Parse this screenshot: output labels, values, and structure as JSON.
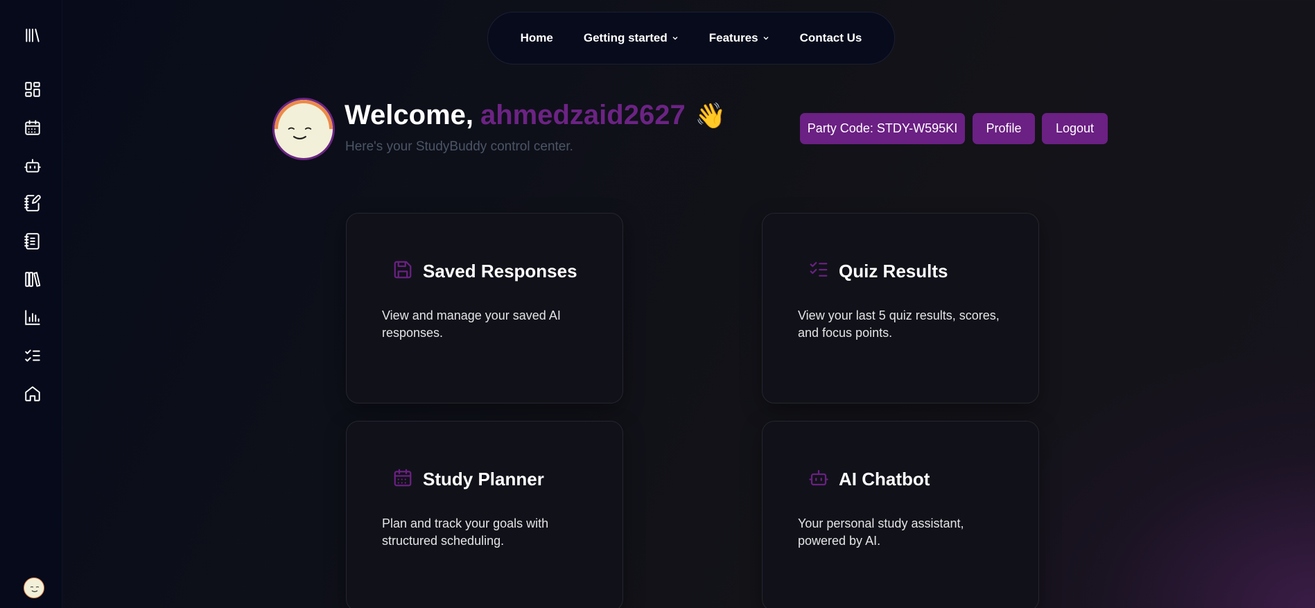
{
  "sidebar": {
    "items": [
      {
        "icon": "library-icon"
      },
      {
        "icon": "dashboard-icon"
      },
      {
        "icon": "calendar-icon"
      },
      {
        "icon": "bot-icon"
      },
      {
        "icon": "notebook-pen-icon"
      },
      {
        "icon": "notebook-text-icon"
      },
      {
        "icon": "books-icon"
      },
      {
        "icon": "bar-chart-icon"
      },
      {
        "icon": "list-checks-icon"
      },
      {
        "icon": "home-icon"
      }
    ]
  },
  "nav": {
    "home": "Home",
    "getting_started": "Getting started",
    "features": "Features",
    "contact": "Contact Us"
  },
  "header": {
    "welcome": "Welcome,",
    "username": "ahmedzaid2627",
    "wave": "👋",
    "subtitle": "Here's your StudyBuddy control center."
  },
  "actions": {
    "party_code": "Party Code: STDY-W595KI",
    "profile": "Profile",
    "logout": "Logout"
  },
  "cards": [
    {
      "title": "Saved Responses",
      "desc": "View and manage your saved AI responses.",
      "icon": "save-icon"
    },
    {
      "title": "Quiz Results",
      "desc": "View your last 5 quiz results, scores, and focus points.",
      "icon": "list-checks-icon"
    },
    {
      "title": "Study Planner",
      "desc": "Plan and track your goals with structured scheduling.",
      "icon": "calendar-icon"
    },
    {
      "title": "AI Chatbot",
      "desc": "Your personal study assistant, powered by AI.",
      "icon": "bot-icon"
    }
  ],
  "colors": {
    "accent": "#6b2083",
    "username": "#6c2384",
    "sidebar_bg": "#060a1a"
  }
}
